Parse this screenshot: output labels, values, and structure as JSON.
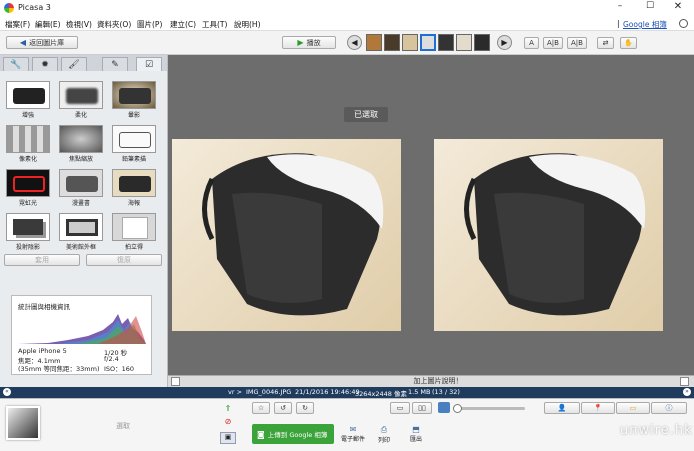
{
  "window": {
    "title": "Picasa 3",
    "app_icon": "picasa-icon"
  },
  "menu": {
    "items": [
      "檔案(F)",
      "編輯(E)",
      "檢視(V)",
      "資料夾(O)",
      "圖片(P)",
      "建立(C)",
      "工具(T)",
      "說明(H)"
    ],
    "google_link": "Google 相簿",
    "separator": "|"
  },
  "toolbar": {
    "back_label": "返回圖片庫",
    "play_label": "播放",
    "text_align_buttons": [
      "A",
      "A|B",
      "A|B"
    ]
  },
  "edit_tabs": [
    "wrench-icon",
    "sun-icon",
    "brush-icon",
    "paint-icon",
    "check-icon"
  ],
  "effects": [
    {
      "label": "增強",
      "style": "bw"
    },
    {
      "label": "柔化",
      "style": "soft"
    },
    {
      "label": "暈影",
      "style": "vignette"
    },
    {
      "label": "像素化",
      "style": "pixel"
    },
    {
      "label": "焦點縮放",
      "style": "focus"
    },
    {
      "label": "鉛筆素描",
      "style": "sketch"
    },
    {
      "label": "霓虹光",
      "style": "neon"
    },
    {
      "label": "漫畫書",
      "style": "comic"
    },
    {
      "label": "海報",
      "style": "poster"
    },
    {
      "label": "投射陰影",
      "style": "shadow"
    },
    {
      "label": "美術館外框",
      "style": "frame"
    },
    {
      "label": "拍立得",
      "style": "polaroid"
    }
  ],
  "effect_actions": {
    "apply": "套用",
    "undo": "復原"
  },
  "info": {
    "title": "統計圖與相機資訊",
    "camera": "Apple iPhone 5",
    "focal": "焦距：4.1mm",
    "equiv": "(35mm 等同焦距：33mm)",
    "shutter": "1/20 秒",
    "aperture": "f/2.4",
    "iso": "ISO：160"
  },
  "main": {
    "selected_label": "已選取"
  },
  "caption": {
    "placeholder": "加上圖片說明！"
  },
  "status": {
    "prefix": "vr >",
    "filename": "IMG_0046.JPG",
    "datetime": "21/1/2016 19:46:49",
    "dimensions": "3264x2448 像素",
    "filesize": "1.5 MB",
    "position": "(13 / 32)"
  },
  "tray": {
    "hold_label": "選取",
    "upload_label": "上傳到 Google 相簿",
    "email_label": "電子郵件",
    "print_label": "列印",
    "export_label": "匯出"
  },
  "watermark": "unwire.hk",
  "colors": {
    "statusbar": "#1f3b5e",
    "upload_green": "#3aa33a",
    "main_bg": "#6d6d6d"
  }
}
